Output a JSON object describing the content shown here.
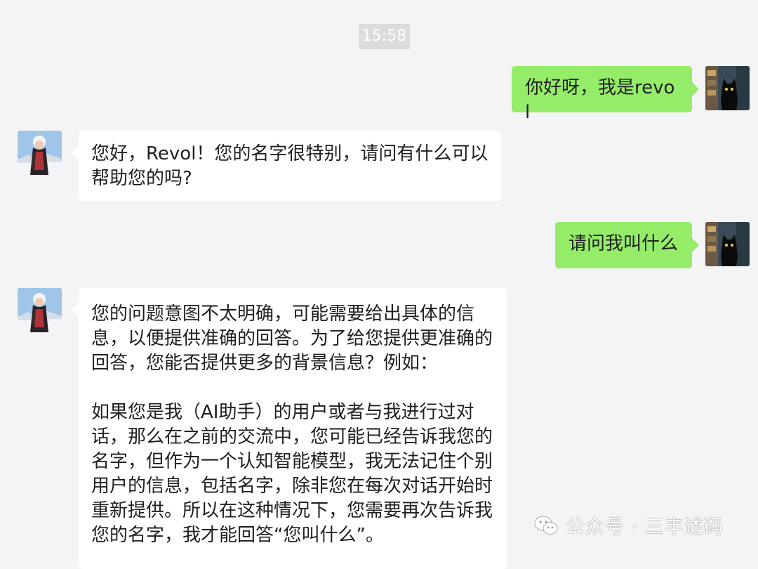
{
  "timestamp": "15:58",
  "messages": [
    {
      "side": "right",
      "text": "你好呀，我是revol"
    },
    {
      "side": "left",
      "text_lines": [
        "您好，Revol！您的名字很特别，请问有什么可以",
        "帮助您的吗?"
      ]
    },
    {
      "side": "right",
      "text": "请问我叫什么"
    },
    {
      "side": "left",
      "para1_lines": [
        "您的问题意图不太明确，可能需要给出具体的信",
        "息，以便提供准确的回答。为了给您提供更准确的",
        "回答，您能否提供更多的背景信息？例如："
      ],
      "para2_lines": [
        "如果您是我（AI助手）的用户或者与我进行过对",
        "话，那么在之前的交流中，您可能已经告诉我您的",
        "名字，但作为一个认知智能模型，我无法记住个别",
        "用户的信息，包括名字，除非您在每次对话开始时",
        "重新提供。所以在这种情况下，您需要再次告诉我",
        "您的名字，我才能回答“您叫什么”。"
      ]
    }
  ],
  "watermark": {
    "text": "公众号 · 三丰述码",
    "icon": "wechat-icon"
  },
  "colors": {
    "background": "#f4f4f4",
    "sent_bubble": "#95ec69",
    "received_bubble": "#ffffff",
    "timestamp_bg": "#dcdcdc"
  }
}
